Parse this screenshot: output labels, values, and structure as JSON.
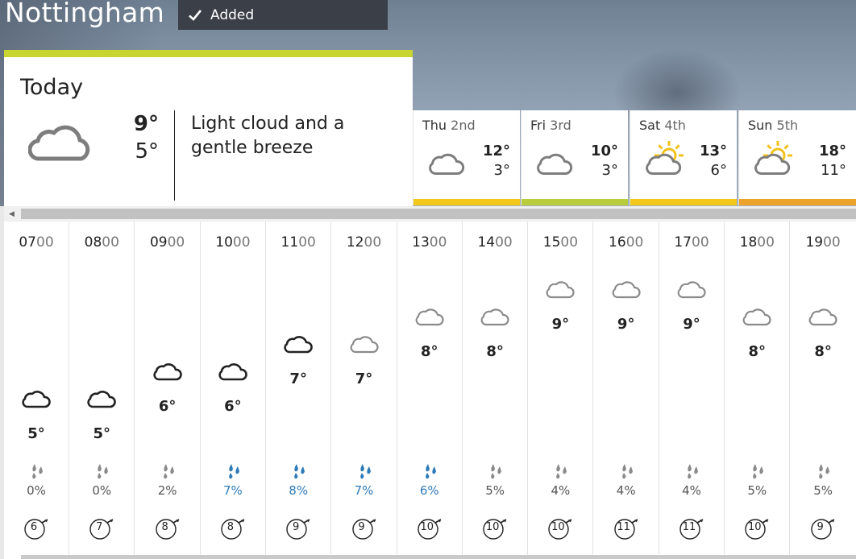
{
  "location": {
    "name": "Nottingham",
    "added_label": "Added"
  },
  "today": {
    "label": "Today",
    "max": "9°",
    "min": "5°",
    "description": "Light cloud and a gentle breeze",
    "icon": "light-cloud-icon"
  },
  "days": [
    {
      "name": "Thu",
      "date": "2nd",
      "max": "12°",
      "min": "3°",
      "icon": "light-cloud-icon",
      "color": "#f2c81b"
    },
    {
      "name": "Fri",
      "date": "3rd",
      "max": "10°",
      "min": "3°",
      "icon": "light-cloud-icon",
      "color": "#b9cd3c"
    },
    {
      "name": "Sat",
      "date": "4th",
      "max": "13°",
      "min": "6°",
      "icon": "sunny-intervals-icon",
      "color": "#f2c81b"
    },
    {
      "name": "Sun",
      "date": "5th",
      "max": "18°",
      "min": "11°",
      "icon": "sunny-intervals-icon",
      "color": "#eda22b"
    }
  ],
  "hours": [
    {
      "hh": "07",
      "mm": "00",
      "temp": "5°",
      "temp_value": 5,
      "rain": "0%",
      "wind": "6",
      "icon_style": "bold"
    },
    {
      "hh": "08",
      "mm": "00",
      "temp": "5°",
      "temp_value": 5,
      "rain": "0%",
      "wind": "7",
      "icon_style": "bold"
    },
    {
      "hh": "09",
      "mm": "00",
      "temp": "6°",
      "temp_value": 6,
      "rain": "2%",
      "wind": "8",
      "icon_style": "bold"
    },
    {
      "hh": "10",
      "mm": "00",
      "temp": "6°",
      "temp_value": 6,
      "rain": "7%",
      "wind": "8",
      "icon_style": "bold"
    },
    {
      "hh": "11",
      "mm": "00",
      "temp": "7°",
      "temp_value": 7,
      "rain": "8%",
      "wind": "9",
      "icon_style": "bold"
    },
    {
      "hh": "12",
      "mm": "00",
      "temp": "7°",
      "temp_value": 7,
      "rain": "7%",
      "wind": "9",
      "icon_style": "light"
    },
    {
      "hh": "13",
      "mm": "00",
      "temp": "8°",
      "temp_value": 8,
      "rain": "6%",
      "wind": "10",
      "icon_style": "light"
    },
    {
      "hh": "14",
      "mm": "00",
      "temp": "8°",
      "temp_value": 8,
      "rain": "5%",
      "wind": "10",
      "icon_style": "light"
    },
    {
      "hh": "15",
      "mm": "00",
      "temp": "9°",
      "temp_value": 9,
      "rain": "4%",
      "wind": "10",
      "icon_style": "light"
    },
    {
      "hh": "16",
      "mm": "00",
      "temp": "9°",
      "temp_value": 9,
      "rain": "4%",
      "wind": "11",
      "icon_style": "light"
    },
    {
      "hh": "17",
      "mm": "00",
      "temp": "9°",
      "temp_value": 9,
      "rain": "4%",
      "wind": "11",
      "icon_style": "light"
    },
    {
      "hh": "18",
      "mm": "00",
      "temp": "8°",
      "temp_value": 8,
      "rain": "5%",
      "wind": "10",
      "icon_style": "light"
    },
    {
      "hh": "19",
      "mm": "00",
      "temp": "8°",
      "temp_value": 8,
      "rain": "5%",
      "wind": "9",
      "icon_style": "light"
    }
  ],
  "colors": {
    "today_accent": "#c8d531",
    "rain_wet": "#2f7bb8",
    "rain_dry": "#888888"
  }
}
